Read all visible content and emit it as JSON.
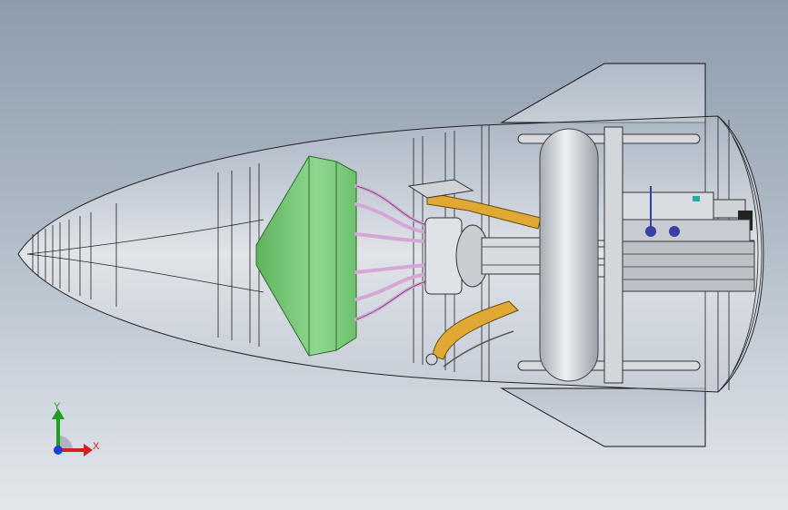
{
  "viewport": {
    "background_top": "#8e9cad",
    "background_bottom": "#e3e7eb"
  },
  "model": {
    "description_icon": "rocket-nose-assembly",
    "colors": {
      "shell": "#d3d8df",
      "bulkhead_green": "#7fcf7f",
      "arm_gold": "#e0a933",
      "tank": "#cfd3d8",
      "wires": "#d6a7d6"
    }
  },
  "triad": {
    "y_label": "Y",
    "x_label": "X",
    "colors": {
      "x": "#d02020",
      "y": "#1f9d1f",
      "z": "#1a3fd0"
    }
  }
}
